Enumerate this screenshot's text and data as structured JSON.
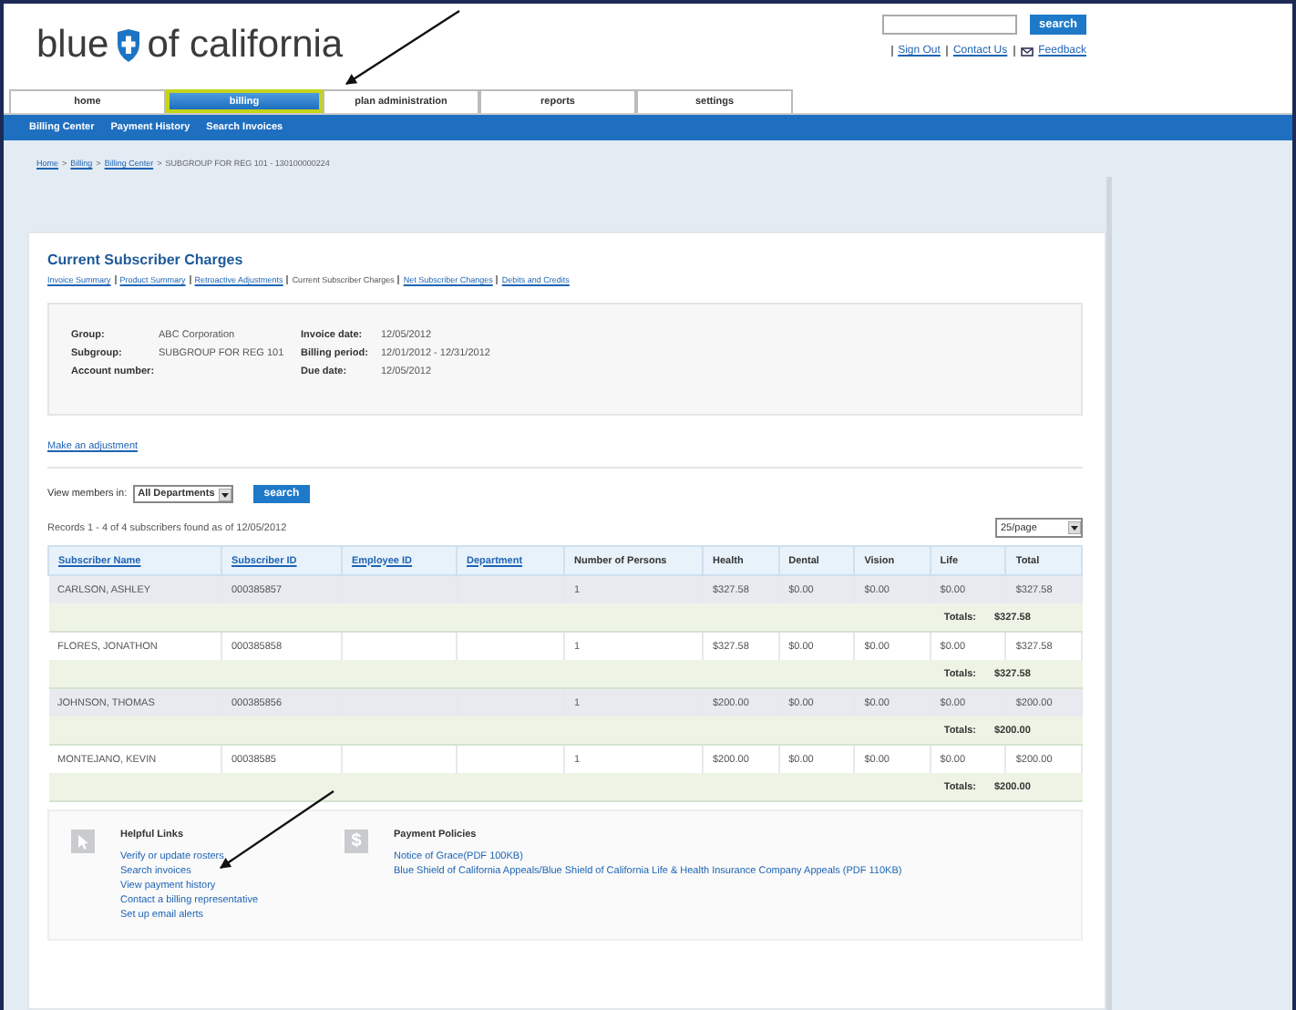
{
  "header": {
    "logo_left": "blue",
    "logo_right": "of california",
    "search_button": "search",
    "links": [
      "Sign Out",
      "Contact Us",
      "Feedback"
    ]
  },
  "nav": [
    {
      "label": "home",
      "selected": false
    },
    {
      "label": "billing",
      "selected": true
    },
    {
      "label": "plan administration",
      "selected": false
    },
    {
      "label": "reports",
      "selected": false
    },
    {
      "label": "settings",
      "selected": false
    }
  ],
  "subnav": [
    "Billing Center",
    "Payment History",
    "Search Invoices"
  ],
  "breadcrumb_separator": ">",
  "breadcrumb": [
    {
      "label": "Home",
      "kind": "link"
    },
    {
      "label": "Billing",
      "kind": "link"
    },
    {
      "label": "Billing Center",
      "kind": "link"
    },
    {
      "label": "SUBGROUP FOR REG 101 - 130100000224",
      "kind": "text"
    }
  ],
  "page_title": "Current Subscriber Charges",
  "section_links": [
    {
      "label": "Invoice Summary",
      "selected": false
    },
    {
      "label": "Product Summary",
      "selected": false
    },
    {
      "label": "Retroactive Adjustments",
      "selected": false
    },
    {
      "label": "Current Subscriber Charges",
      "selected": true
    },
    {
      "label": "Net Subscriber Changes",
      "selected": false
    },
    {
      "label": "Debits and Credits",
      "selected": false
    }
  ],
  "info_left": [
    {
      "label": "Group:",
      "value": "ABC Corporation"
    },
    {
      "label": "Subgroup:",
      "value": "SUBGROUP FOR REG 101"
    },
    {
      "label": "Account number:"
    }
  ],
  "info_right": [
    {
      "label": "Invoice date:",
      "value": "12/05/2012"
    },
    {
      "label": "Billing period:",
      "value": "12/01/2012 - 12/31/2012"
    },
    {
      "label": "Due date:",
      "value": "12/05/2012"
    }
  ],
  "adjustment_link": "Make an adjustment",
  "filter": {
    "label": "View members in:",
    "value": "All Departments",
    "button": "search"
  },
  "records_text": "Records 1 - 4 of 4 subscribers found as of 12/05/2012",
  "page_size": "25/page",
  "table": {
    "columns": [
      {
        "label": "Subscriber Name",
        "kind": "link"
      },
      {
        "label": "Subscriber ID",
        "kind": "link"
      },
      {
        "label": "Employee ID",
        "kind": "link"
      },
      {
        "label": "Department",
        "kind": "link"
      },
      {
        "label": "Number of Persons",
        "kind": "text"
      },
      {
        "label": "Health",
        "kind": "text"
      },
      {
        "label": "Dental",
        "kind": "text"
      },
      {
        "label": "Vision",
        "kind": "text"
      },
      {
        "label": "Life",
        "kind": "text"
      },
      {
        "label": "Total",
        "kind": "text"
      }
    ],
    "rows": [
      {
        "cells": [
          "CARLSON, ASHLEY",
          "000385857",
          "",
          "",
          "1",
          "$327.58",
          "$0.00",
          "$0.00",
          "$0.00",
          "$327.58"
        ],
        "total_label": "Totals:",
        "total": "$327.58"
      },
      {
        "cells": [
          "FLORES, JONATHON",
          "000385858",
          "",
          "",
          "1",
          "$327.58",
          "$0.00",
          "$0.00",
          "$0.00",
          "$327.58"
        ],
        "total_label": "Totals:",
        "total": "$327.58"
      },
      {
        "cells": [
          "JOHNSON, THOMAS",
          "000385856",
          "",
          "",
          "1",
          "$200.00",
          "$0.00",
          "$0.00",
          "$0.00",
          "$200.00"
        ],
        "total_label": "Totals:",
        "total": "$200.00"
      },
      {
        "cells": [
          "MONTEJANO, KEVIN",
          "00038585",
          "",
          "",
          "1",
          "$200.00",
          "$0.00",
          "$0.00",
          "$0.00",
          "$200.00"
        ],
        "total_label": "Totals:",
        "total": "$200.00"
      }
    ]
  },
  "helpful_links": {
    "title": "Helpful Links",
    "links": [
      "Verify or update rosters",
      "Search invoices",
      "View payment history",
      "Contact a billing representative",
      "Set up email alerts"
    ]
  },
  "payment_policies": {
    "icon": "$",
    "title": "Payment Policies",
    "links": [
      "Notice of Grace(PDF 100KB)",
      "Blue Shield of California Appeals/Blue Shield of California Life & Health Insurance Company Appeals (PDF 110KB)"
    ]
  }
}
